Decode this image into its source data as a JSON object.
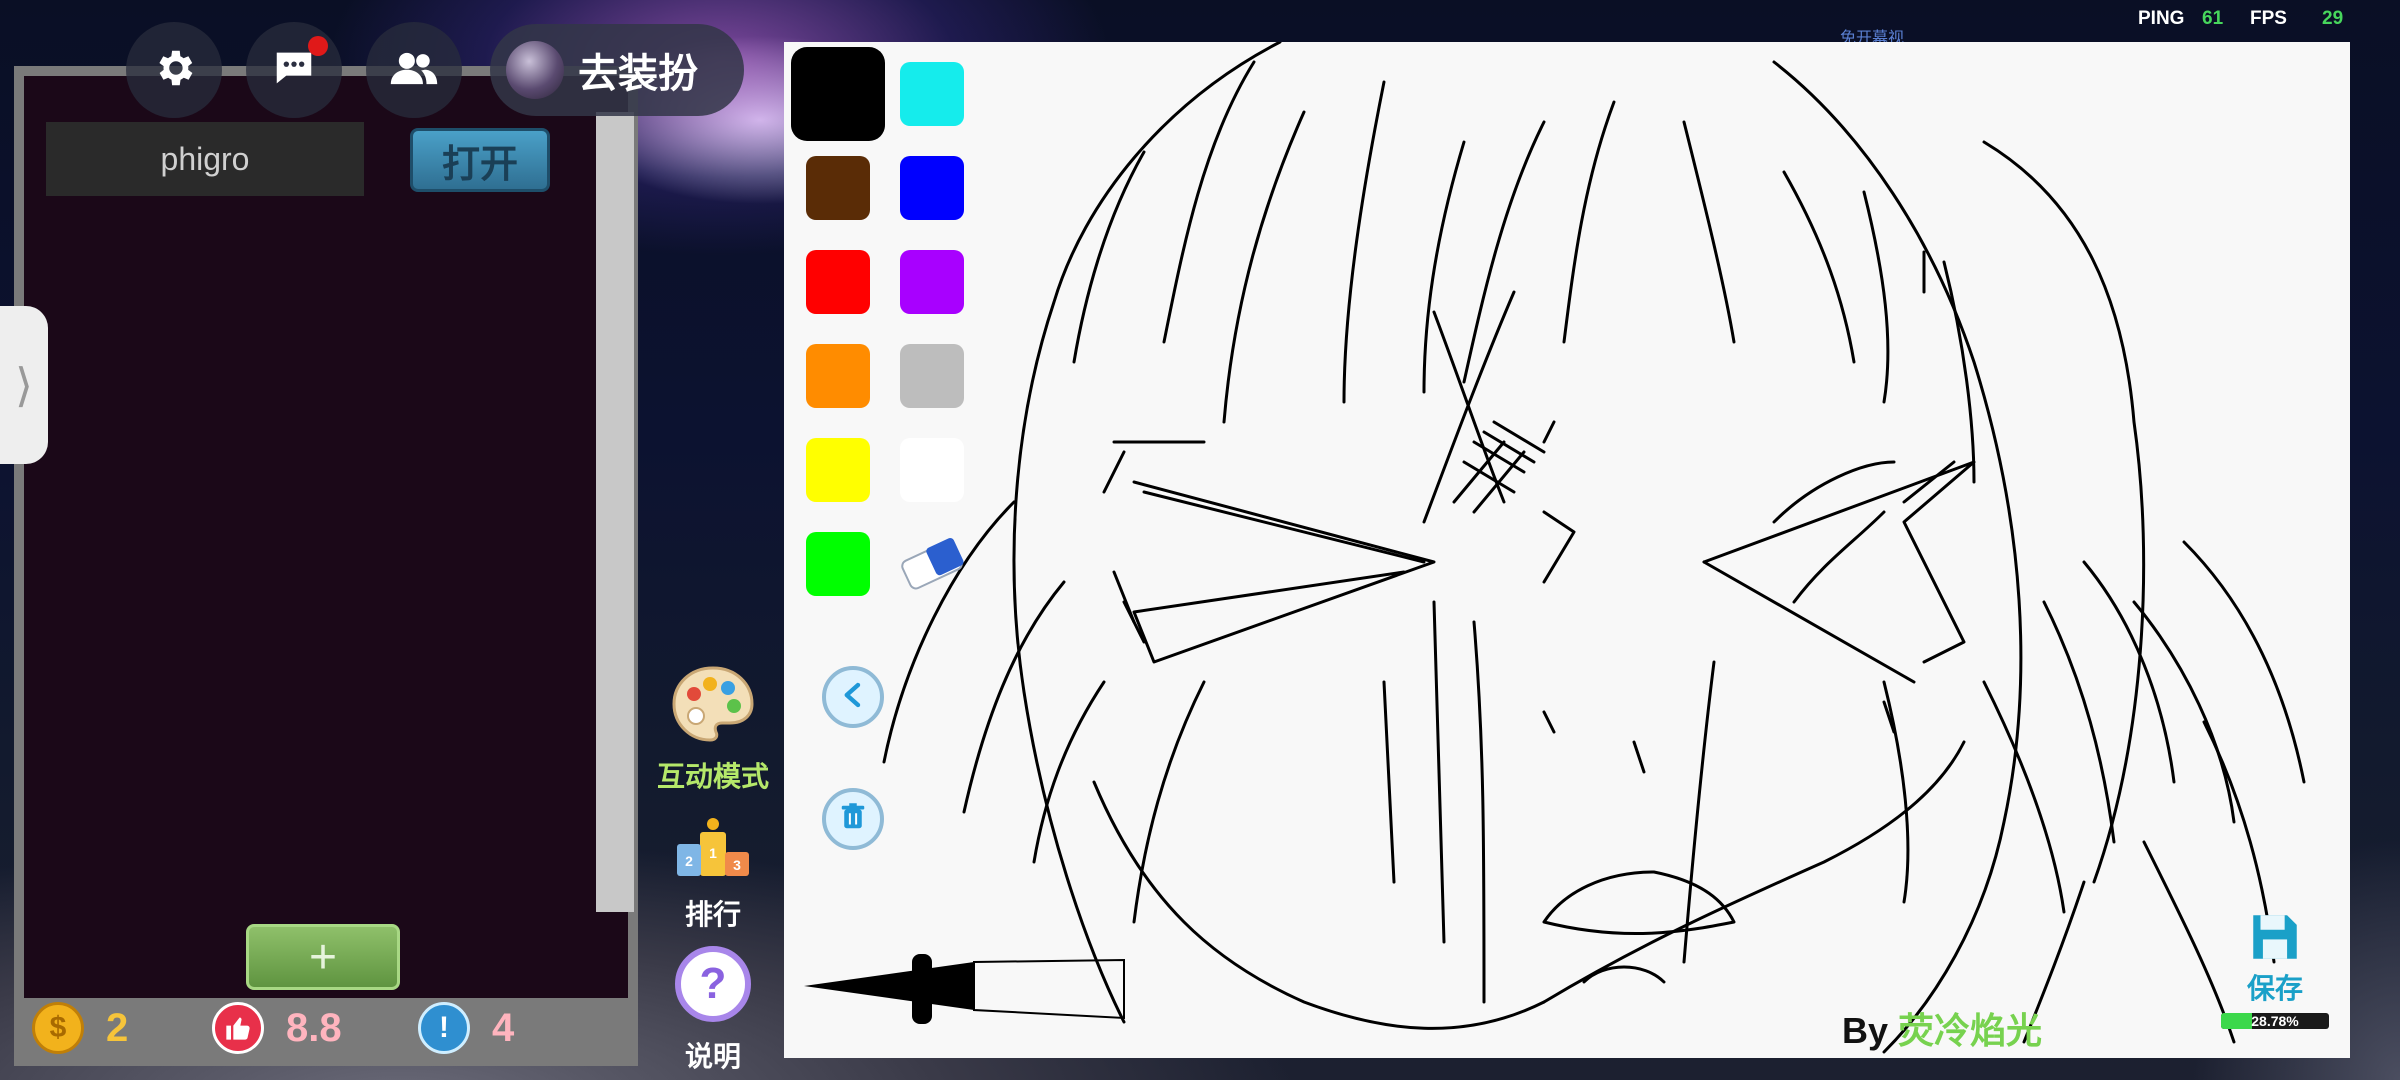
{
  "hud": {
    "ping_label": "PING",
    "ping_value": "61",
    "fps_label": "FPS",
    "fps_value": "29",
    "faint_text": "免开幕视"
  },
  "top_bar": {
    "settings_icon": "gear-icon",
    "chat_icon": "chat-bubble-icon",
    "friends_icon": "people-icon",
    "dress_up_label": "去装扮"
  },
  "left_panel": {
    "name_value": "phigro",
    "open_label": "打开",
    "add_label": "+",
    "stats": {
      "coins": "2",
      "likes": "8.8",
      "warnings": "4"
    },
    "colors": {
      "coin": "#f2b21c",
      "like": "#e8304a",
      "warning": "#2f8fd0"
    }
  },
  "side_tab_label": "⟩",
  "middle_menu": {
    "interactive_mode_label": "互动模式",
    "rank_label": "排行",
    "help_label": "说明"
  },
  "canvas": {
    "palette": [
      {
        "name": "black",
        "color": "#000000",
        "selected": true
      },
      {
        "name": "cyan",
        "color": "#15ecec",
        "selected": false
      },
      {
        "name": "brown",
        "color": "#5a2c06",
        "selected": false
      },
      {
        "name": "blue",
        "color": "#0000ff",
        "selected": false
      },
      {
        "name": "red",
        "color": "#ff0000",
        "selected": false
      },
      {
        "name": "purple",
        "color": "#a800ff",
        "selected": false
      },
      {
        "name": "orange",
        "color": "#ff8c00",
        "selected": false
      },
      {
        "name": "gray",
        "color": "#bdbdbd",
        "selected": false
      },
      {
        "name": "yellow",
        "color": "#ffff00",
        "selected": false
      },
      {
        "name": "white",
        "color": "#ffffff",
        "selected": false
      },
      {
        "name": "green",
        "color": "#00ff00",
        "selected": false
      }
    ],
    "byline_prefix": "By ",
    "author": "荧冷焰光",
    "save_label": "保存",
    "save_progress_text": "28.78%",
    "save_progress": 0.2878
  }
}
